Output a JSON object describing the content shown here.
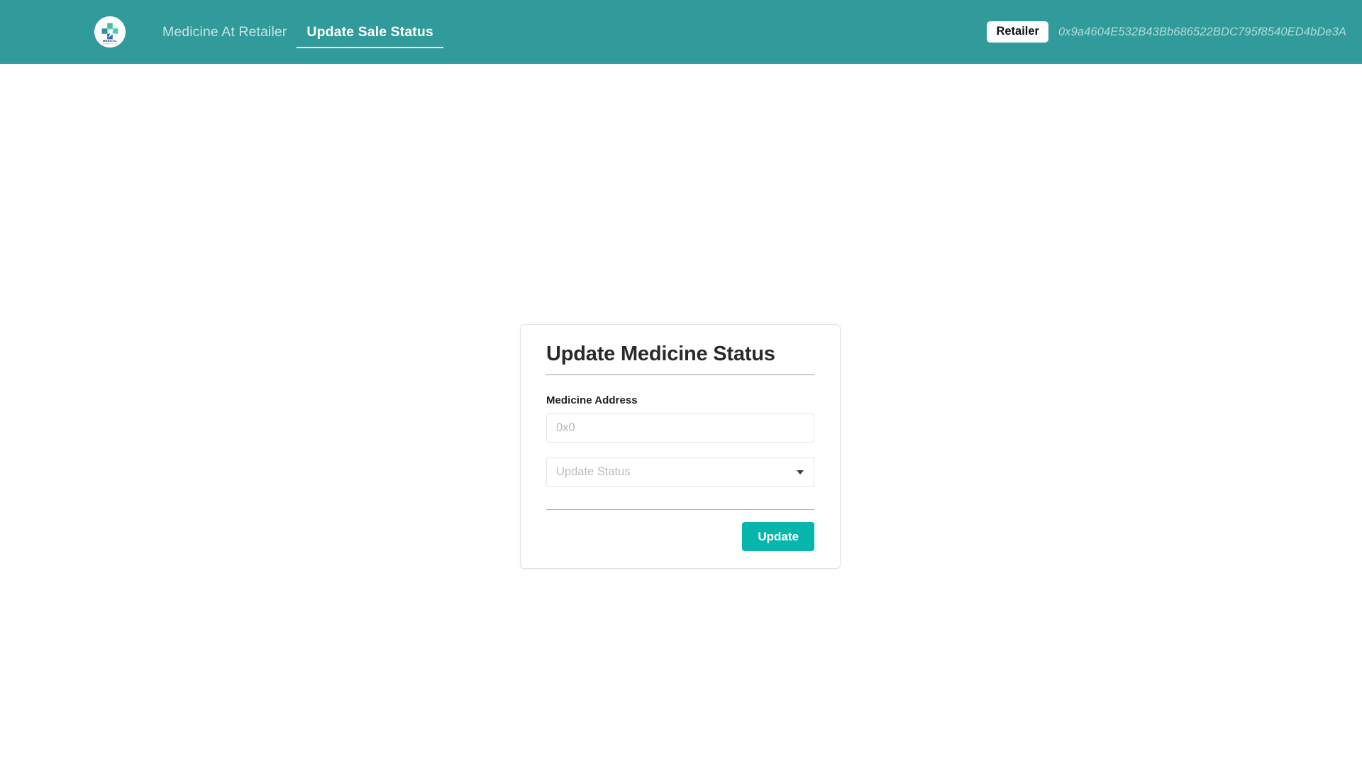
{
  "colors": {
    "navbar_bg": "#319b9b",
    "accent_button": "#06b6ac",
    "card_border": "#e3e3e3",
    "badge_bg": "#ffffff",
    "input_border": "#e6e6e6"
  },
  "navbar": {
    "logo": {
      "icon": "medical-cross-logo",
      "wordmark": "MEDICAL"
    },
    "tabs": [
      {
        "label": "Medicine At Retailer",
        "active": false
      },
      {
        "label": "Update Sale Status",
        "active": true
      }
    ],
    "role_badge": "Retailer",
    "account_address": "0x9a4604E532B43Bb686522BDC795f8540ED4bDe3A"
  },
  "card": {
    "title": "Update Medicine Status",
    "medicine_address": {
      "label": "Medicine Address",
      "value": "",
      "placeholder": "0x0"
    },
    "status_select": {
      "selected_label": "Update Status",
      "caret_icon": "chevron-down-icon",
      "options": [
        "Update Status"
      ]
    },
    "submit_button": "Update"
  }
}
